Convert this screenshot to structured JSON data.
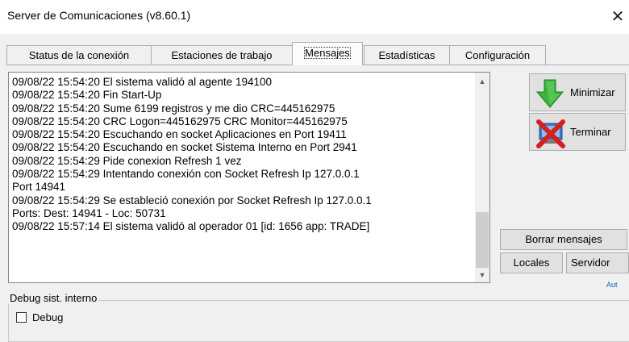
{
  "window": {
    "title": "Server de Comunicaciones (v8.60.1)",
    "close_glyph": "✕"
  },
  "tabs": [
    {
      "label": "Status de la conexión",
      "active": false
    },
    {
      "label": "Estaciones de trabajo",
      "active": false
    },
    {
      "label": "Mensajes",
      "active": true
    },
    {
      "label": "Estadísticas",
      "active": false
    },
    {
      "label": "Configuración",
      "active": false
    }
  ],
  "messages": [
    "09/08/22 15:54:20 El sistema validó al agente 194100",
    "09/08/22 15:54:20 Fin Start-Up",
    "09/08/22 15:54:20 Sume 6199 registros y me dio CRC=445162975",
    "09/08/22 15:54:20 CRC Logon=445162975 CRC Monitor=445162975",
    "09/08/22 15:54:20 Escuchando en socket Aplicaciones en  Port 19411",
    "09/08/22 15:54:20 Escuchando en socket Sistema Interno en  Port 2941",
    "09/08/22 15:54:29 Pide conexion Refresh 1 vez",
    "09/08/22 15:54:29 Intentando conexión con Socket Refresh Ip 127.0.0.1",
    "Port 14941",
    "09/08/22 15:54:29 Se estableció conexión por Socket Refresh Ip 127.0.0.1",
    "Ports: Dest: 14941 - Loc: 50731",
    "09/08/22 15:57:14 El sistema validó al operador 01 [id: 1656 app: TRADE]"
  ],
  "buttons": {
    "minimize": "Minimizar",
    "terminate": "Terminar",
    "clear_messages": "Borrar mensajes",
    "locales": "Locales",
    "servidor": "Servidor"
  },
  "truncated_link": "Aut",
  "debug_group": {
    "title": "Debug sist. interno",
    "checkbox_label": "Debug",
    "checked": false
  },
  "icons": {
    "minimize": "green-down-arrow-icon",
    "terminate": "red-x-monitor-icon"
  }
}
